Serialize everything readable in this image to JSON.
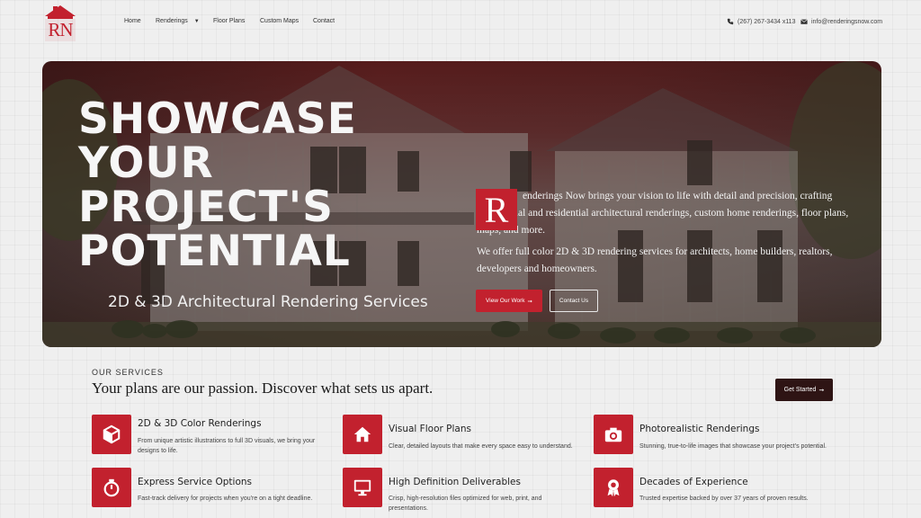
{
  "brand": {
    "logo_text": "RN",
    "logo_color": "#c2212e"
  },
  "nav": {
    "items": [
      {
        "label": "Home"
      },
      {
        "label": "Renderings",
        "has_dropdown": true
      },
      {
        "label": "Floor Plans"
      },
      {
        "label": "Custom Maps"
      },
      {
        "label": "Contact"
      }
    ]
  },
  "contact": {
    "phone": "(267) 267-3434 x113",
    "email": "info@renderingsnow.com"
  },
  "hero": {
    "title": "SHOWCASE YOUR PROJECT'S POTENTIAL",
    "subtitle": "2D & 3D Architectural Rendering Services",
    "dropcap": "R",
    "paragraph1": "enderings Now brings your vision to life with detail and precision, crafting commercial and residential architectural renderings, custom home renderings, floor plans, maps, and more.",
    "paragraph2": "We offer full color 2D & 3D rendering services for architects, home builders, realtors, developers and homeowners.",
    "btn_work": "View Our Work",
    "btn_contact": "Contact Us"
  },
  "services": {
    "kicker": "OUR SERVICES",
    "heading": "Your plans are our passion. Discover what sets us apart.",
    "btn_start": "Get Started",
    "items": [
      {
        "title": "2D & 3D Color Renderings",
        "desc": "From unique artistic illustrations to full 3D visuals, we bring your designs to life.",
        "icon": "cube-icon"
      },
      {
        "title": "Visual Floor Plans",
        "desc": "Clear, detailed layouts that make every space easy to understand.",
        "icon": "home-icon"
      },
      {
        "title": "Photorealistic Renderings",
        "desc": "Stunning, true-to-life images that showcase your project's potential.",
        "icon": "camera-icon"
      },
      {
        "title": "Express Service Options",
        "desc": "Fast-track delivery for projects when you're on a tight deadline.",
        "icon": "stopwatch-icon"
      },
      {
        "title": "High Definition Deliverables",
        "desc": "Crisp, high-resolution files optimized for web, print, and presentations.",
        "icon": "monitor-icon"
      },
      {
        "title": "Decades of Experience",
        "desc": "Trusted expertise backed by over 37 years of proven results.",
        "icon": "award-icon"
      }
    ]
  },
  "colors": {
    "accent": "#c2212e",
    "dark": "#2e1414"
  }
}
